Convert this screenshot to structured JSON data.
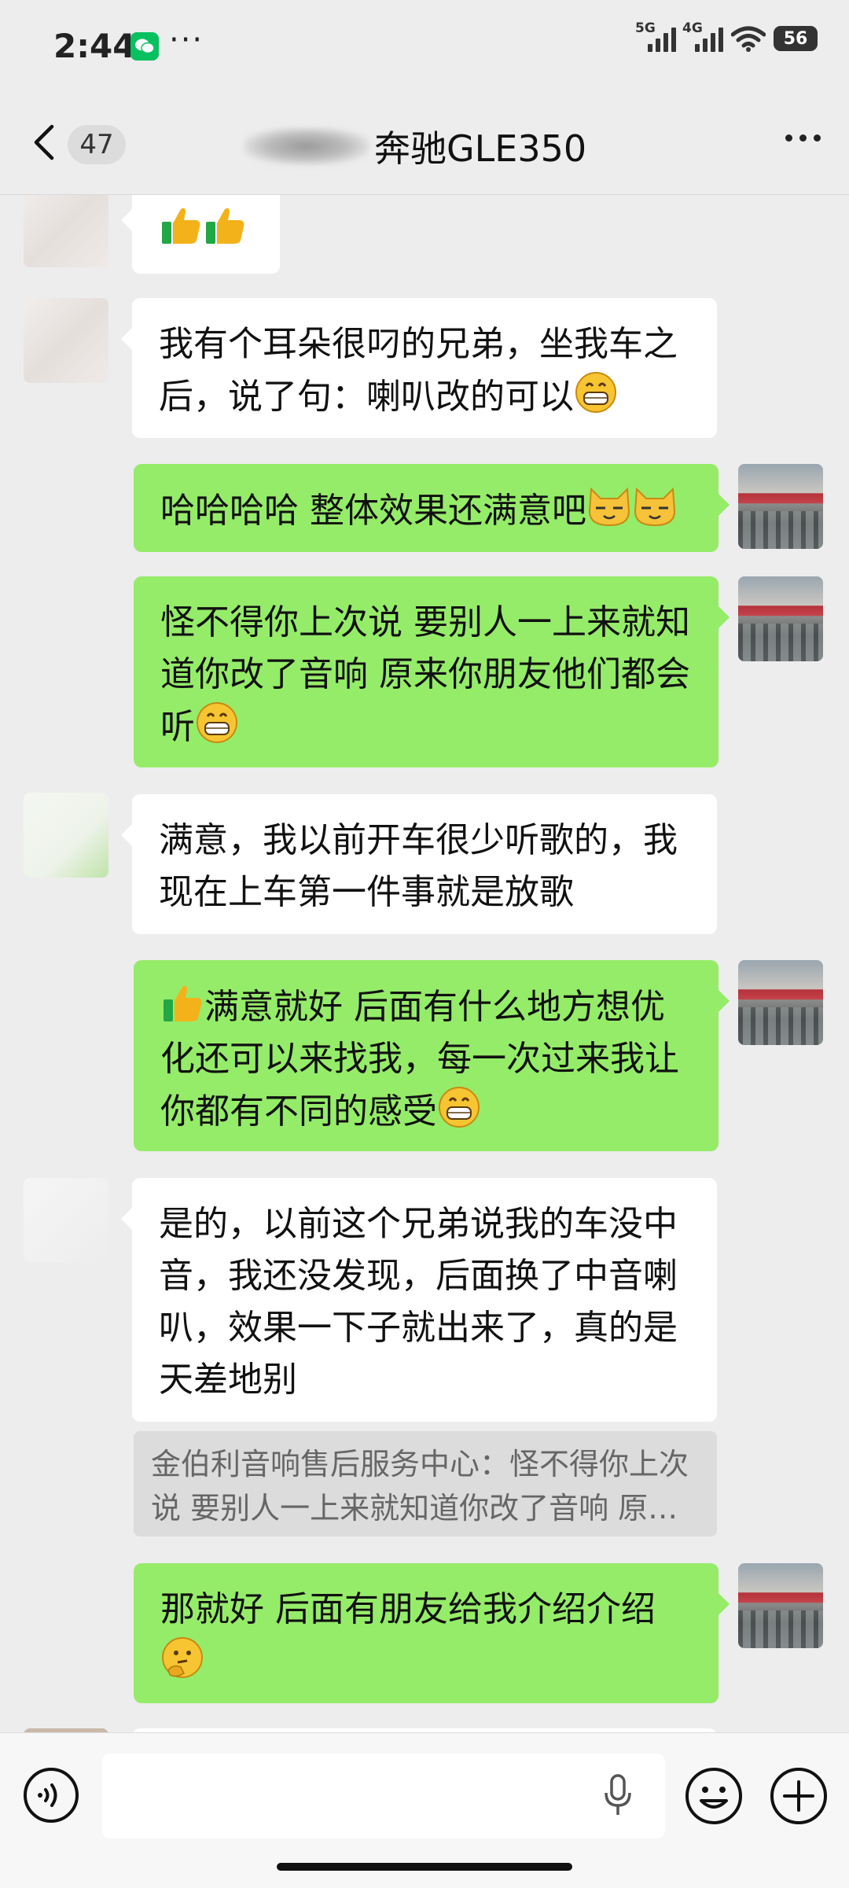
{
  "status_bar": {
    "time": "2:44",
    "more": "···",
    "signal_labels": [
      "5G",
      "4G"
    ],
    "battery": "56"
  },
  "header": {
    "unread_count": "47",
    "title": "奔驰GLE350"
  },
  "messages": [
    {
      "side": "left",
      "text": "",
      "emoji": [
        "thumbs-up",
        "thumbs-up"
      ]
    },
    {
      "side": "left",
      "text": "我有个耳朵很叼的兄弟，坐我车之后，说了句：喇叭改的可以",
      "emoji": [
        "grin"
      ]
    },
    {
      "side": "right",
      "text": "哈哈哈哈 整体效果还满意吧",
      "emoji": [
        "cat",
        "cat"
      ]
    },
    {
      "side": "right",
      "text": "怪不得你上次说 要别人一上来就知道你改了音响 原来你朋友他们都会听",
      "emoji": [
        "grin"
      ]
    },
    {
      "side": "left",
      "text": "满意，我以前开车很少听歌的，我现在上车第一件事就是放歌",
      "emoji": []
    },
    {
      "side": "right",
      "text": "满意就好 后面有什么地方想优化还可以来找我，每一次过来我让你都有不同的感受",
      "emoji_prefix": [
        "thumbs-up"
      ],
      "emoji": [
        "grin"
      ]
    },
    {
      "side": "left",
      "text": "是的，以前这个兄弟说我的车没中音，我还没发现，后面换了中音喇叭，效果一下子就出来了，真的是天差地别",
      "emoji": []
    },
    {
      "side": "right",
      "text": "那就好 后面有朋友给我介绍介绍",
      "emoji": [
        "thinking"
      ]
    }
  ],
  "quote": "金伯利音响售后服务中心：怪不得你上次说 要别人一上来就知道你改了音响 原来你朋友他们都会听",
  "input_bar": {
    "placeholder": "",
    "icons": [
      "voice-icon",
      "mic-icon",
      "emoji-icon",
      "plus-icon"
    ]
  },
  "colors": {
    "my_bubble": "#95ec69",
    "their_bubble": "#ffffff",
    "background": "#ededed",
    "wechat": "#07c160"
  }
}
